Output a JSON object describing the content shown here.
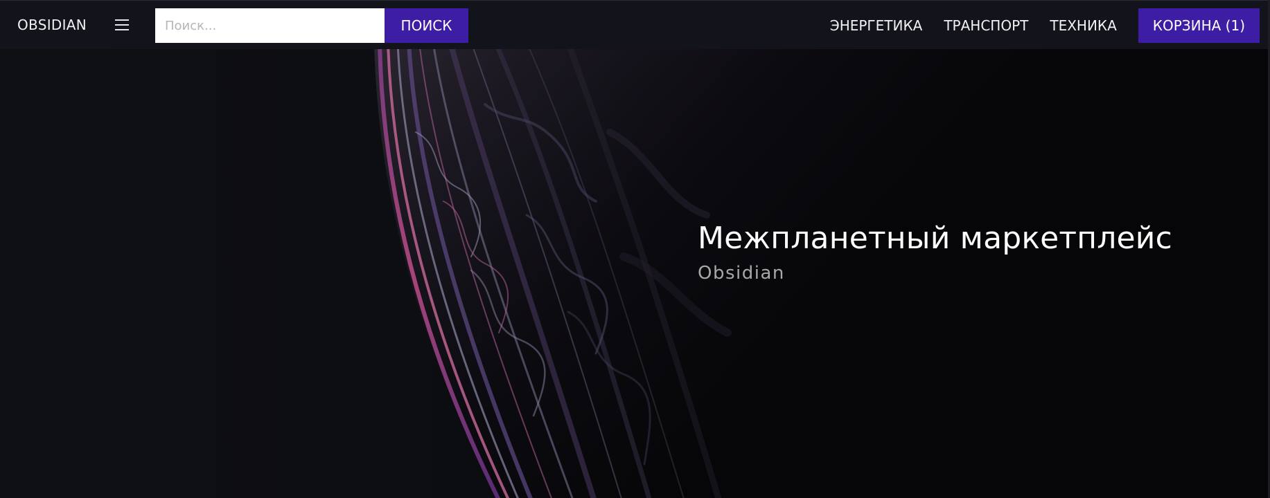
{
  "navbar": {
    "brand": "OBSIDIAN",
    "menu_icon": "hamburger-menu-icon",
    "search": {
      "placeholder": "Поиск...",
      "value": "",
      "button_label": "ПОИСК"
    },
    "links": [
      {
        "label": "ЭНЕРГЕТИКА"
      },
      {
        "label": "ТРАНСПОРТ"
      },
      {
        "label": "ТЕХНИКА"
      }
    ],
    "cart_label": "КОРЗИНА (1)"
  },
  "hero": {
    "title": "Межпланетный маркетплейс",
    "subtitle": "Obsidian"
  },
  "colors": {
    "navbar_bg": "#13131c",
    "accent": "#3d1da3",
    "page_bg": "#0d0e12",
    "text": "#f2f2f2",
    "subtitle": "#a8a8a8"
  }
}
